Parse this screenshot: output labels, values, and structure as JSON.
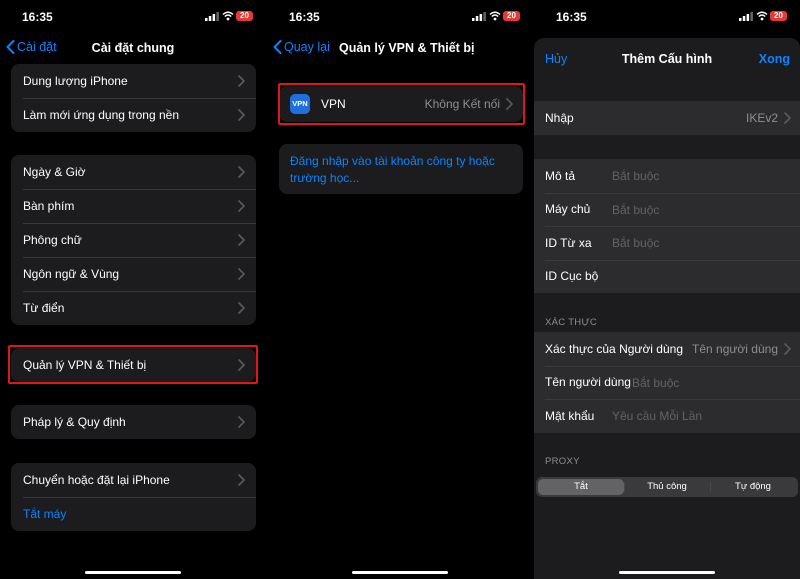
{
  "status_bar": {
    "time": "16:35",
    "battery": "20"
  },
  "panel1": {
    "back_label": "Cài đặt",
    "title": "Cài đặt chung",
    "group1": [
      "Dung lượng iPhone",
      "Làm mới ứng dụng trong nền"
    ],
    "group2": [
      "Ngày & Giờ",
      "Bàn phím",
      "Phông chữ",
      "Ngôn ngữ & Vùng",
      "Từ điển"
    ],
    "group3": [
      "Quản lý VPN & Thiết bị"
    ],
    "group4": [
      "Pháp lý & Quy định"
    ],
    "group5": [
      "Chuyển hoặc đặt lại iPhone"
    ],
    "shutdown": "Tắt máy"
  },
  "panel2": {
    "back_label": "Quay lại",
    "title": "Quản lý VPN & Thiết bị",
    "vpn_icon_text": "VPN",
    "vpn_label": "VPN",
    "vpn_status": "Không Kết nối",
    "login_link": "Đăng nhập vào tài khoản công ty hoặc trường học..."
  },
  "panel3": {
    "cancel": "Hủy",
    "title": "Thêm Cấu hình",
    "done": "Xong",
    "type_label": "Nhập",
    "type_value": "IKEv2",
    "description_label": "Mô tả",
    "description_placeholder": "Bắt buộc",
    "server_label": "Máy chủ",
    "server_placeholder": "Bắt buộc",
    "remote_id_label": "ID Từ xa",
    "remote_id_placeholder": "Bắt buộc",
    "local_id_label": "ID Cục bộ",
    "auth_section": "XÁC THỰC",
    "user_auth_label": "Xác thực của Người dùng",
    "user_auth_value": "Tên người dùng",
    "username_label": "Tên người dùng",
    "username_placeholder": "Bắt buộc",
    "password_label": "Mật khẩu",
    "password_placeholder": "Yêu cầu Mỗi Lần",
    "proxy_section": "PROXY",
    "proxy_options": [
      "Tắt",
      "Thủ công",
      "Tự động"
    ],
    "proxy_selected": "Tắt"
  },
  "colors": {
    "accent": "#0a84ff",
    "highlight": "#e0161b",
    "background": "#000000",
    "cell": "#1c1c1e"
  }
}
